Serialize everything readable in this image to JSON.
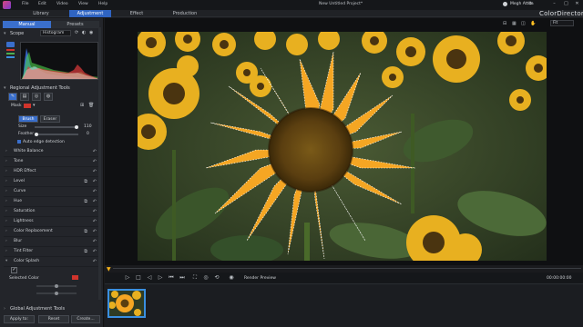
{
  "app": {
    "document_title": "New Untitled Project*",
    "user": "Megh Attila",
    "brand": "ColorDirector"
  },
  "menu": [
    "File",
    "Edit",
    "Video",
    "View",
    "Help"
  ],
  "mode_tabs": [
    "Library",
    "Adjustment",
    "Effect",
    "Production"
  ],
  "active_mode": "Adjustment",
  "sub_tabs": [
    "Manual",
    "Presets"
  ],
  "scope": {
    "label": "Scope",
    "select_value": "Histogram"
  },
  "regional": {
    "label": "Regional Adjustment Tools",
    "mask_label": "Mask",
    "brush_label": "Brush",
    "eraser_label": "Eraser",
    "size_label": "Size",
    "size_value": "110",
    "feather_label": "Feather",
    "feather_value": "0",
    "auto_edge_label": "Auto edge detection"
  },
  "adjustments": [
    "White Balance",
    "Tone",
    "HDR Effect",
    "Level",
    "Curve",
    "Hue",
    "Saturation",
    "Lightness",
    "Color Replacement",
    "Blur",
    "Tint Filter",
    "Color Splash"
  ],
  "color_splash": {
    "selected_color_label": "Selected Color",
    "selected_color": "#d0342c"
  },
  "global": {
    "label": "Global Adjustment Tools"
  },
  "bottom_buttons": [
    "Apply to:",
    "Reset",
    "Create..."
  ],
  "transport": {
    "render_label": "Render Preview",
    "timecode": "00:00:00:00"
  },
  "zoom": "Fit",
  "colors": {
    "accent": "#3a6fcc",
    "highlight_thumb": "#3a8fe0",
    "sunflower": "#f5a623"
  },
  "icons": [
    "logo-icon",
    "minimize-icon",
    "maximize-icon",
    "close-icon",
    "chevron-icon",
    "undo-icon",
    "copy-icon",
    "play-icon",
    "stop-icon",
    "prev-icon",
    "next-icon",
    "eye-icon"
  ]
}
